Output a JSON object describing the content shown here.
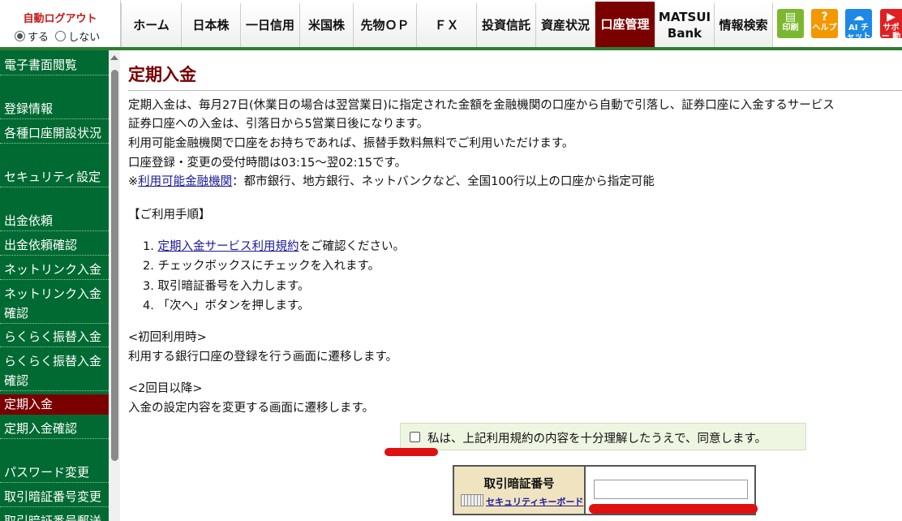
{
  "header": {
    "auto_logout": {
      "title": "自動ログアウト",
      "opt_on": "する",
      "opt_off": "しない",
      "selected": "する"
    },
    "tabs": [
      {
        "label": "ホーム"
      },
      {
        "label": "日本株"
      },
      {
        "label": "一日信用"
      },
      {
        "label": "米国株"
      },
      {
        "label": "先物ＯＰ"
      },
      {
        "label": "ＦＸ"
      },
      {
        "label": "投資信託"
      },
      {
        "label": "資産状況"
      },
      {
        "label": "口座管理",
        "active": true
      },
      {
        "label": "MATSUI Bank"
      },
      {
        "label": "情報検索"
      }
    ],
    "icon_buttons": [
      {
        "label": "印刷",
        "icon": "print-icon",
        "color": "#7cb82f"
      },
      {
        "label": "ヘルプ",
        "icon": "help-icon",
        "color": "#f39800"
      },
      {
        "label": "AI チャット",
        "icon": "ai-chat-icon",
        "color": "#1e88e5"
      },
      {
        "label": "サポー 動画",
        "icon": "support-video-icon",
        "color": "#e02020"
      }
    ]
  },
  "sidebar": {
    "items": [
      {
        "label": "電子書面閲覧"
      },
      {
        "label": "登録情報"
      },
      {
        "label": "各種口座開設状況"
      },
      {
        "label": "セキュリティ設定"
      },
      {
        "label": "出金依頼"
      },
      {
        "label": "出金依頼確認"
      },
      {
        "label": "ネットリンク入金"
      },
      {
        "label": "ネットリンク入金確認"
      },
      {
        "label": "らくらく振替入金"
      },
      {
        "label": "らくらく振替入金確認"
      },
      {
        "label": "定期入金",
        "active": true
      },
      {
        "label": "定期入金確認"
      },
      {
        "label": "パスワード変更"
      },
      {
        "label": "取引暗証番号変更"
      },
      {
        "label": "取引暗証番号郵送"
      }
    ]
  },
  "main": {
    "title": "定期入金",
    "intro": [
      "定期入金は、毎月27日(休業日の場合は翌営業日)に指定された金額を金融機関の口座から自動で引落し、証券口座に入金するサービス",
      "証券口座への入金は、引落日から5営業日後になります。",
      "利用可能金融機関で口座をお持ちであれば、振替手数料無料でご利用いただけます。",
      "口座登録・変更の受付時間は03:15～翌02:15です。"
    ],
    "note_prefix": "※",
    "note_link": "利用可能金融機関",
    "note_text": "：都市銀行、地方銀行、ネットバンクなど、全国100行以上の口座から指定可能",
    "procedure_title": "【ご利用手順】",
    "steps": [
      {
        "num": "1.",
        "link": "定期入金サービス利用規約",
        "text": "をご確認ください。"
      },
      {
        "num": "2.",
        "text": "チェックボックスにチェックを入れます。"
      },
      {
        "num": "3.",
        "text": "取引暗証番号を入力します。"
      },
      {
        "num": "4.",
        "text": "「次へ」ボタンを押します。"
      }
    ],
    "first_title": "<初回利用時>",
    "first_text": "利用する銀行口座の登録を行う画面に遷移します。",
    "second_title": "<2回目以降>",
    "second_text": "入金の設定内容を変更する画面に遷移します。",
    "agree_label": "私は、上記利用規約の内容を十分理解したうえで、同意します。",
    "agree_checked": false,
    "pin_label": "取引暗証番号",
    "security_keyboard": "セキュリティキーボード",
    "pin_value": ""
  }
}
